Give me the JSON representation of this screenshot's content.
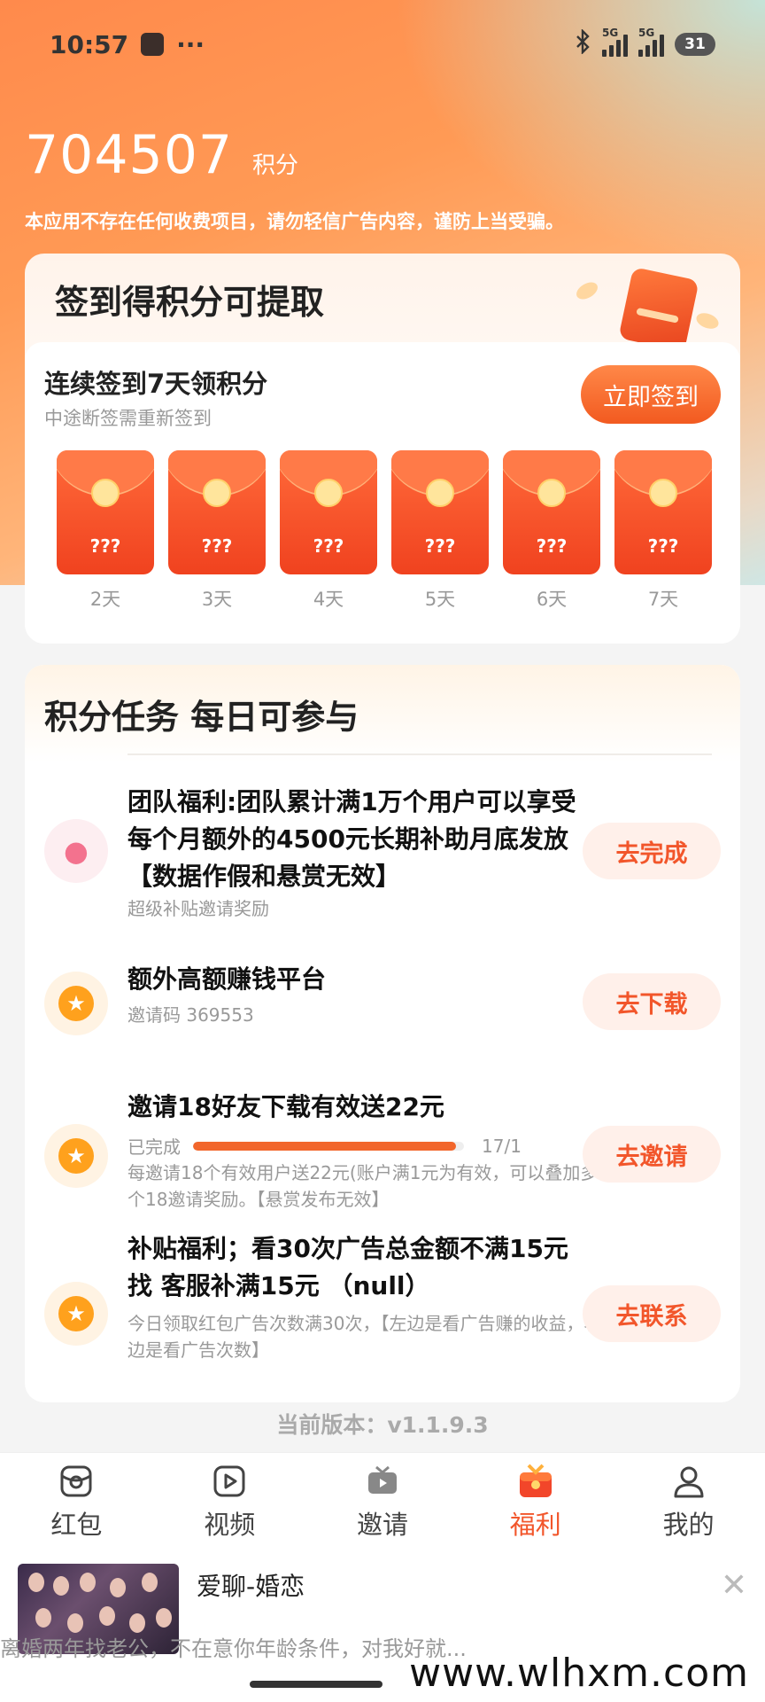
{
  "status_bar": {
    "time": "10:57",
    "more": "···",
    "signal_1": "5G",
    "signal_2": "5G",
    "battery": "31"
  },
  "header": {
    "points_value": "704507",
    "points_unit": "积分",
    "notice": "本应用不存在任何收费项目，请勿轻信广告内容，谨防上当受骗。"
  },
  "checkin": {
    "title": "签到得积分可提取",
    "sub_title": "连续签到7天领积分",
    "hint": "中途断签需重新签到",
    "button": "立即签到",
    "days": [
      {
        "reward": "???",
        "label": "2天"
      },
      {
        "reward": "???",
        "label": "3天"
      },
      {
        "reward": "???",
        "label": "4天"
      },
      {
        "reward": "???",
        "label": "5天"
      },
      {
        "reward": "???",
        "label": "6天"
      },
      {
        "reward": "???",
        "label": "7天"
      }
    ]
  },
  "tasks": {
    "title": "积分任务  每日可参与",
    "items": [
      {
        "title": "团队福利:团队累计满1万个用户可以享受每个月额外的4500元长期补助月底发放【数据作假和悬赏无效】",
        "sub": "超级补贴邀请奖励",
        "button": "去完成"
      },
      {
        "title": "额外高额赚钱平台",
        "sub": "邀请码 369553",
        "button": "去下载"
      },
      {
        "title": "邀请18好友下载有效送22元",
        "progress_label": "已完成",
        "progress_fraction": 0.97,
        "progress_count": "17/1",
        "sub": "每邀请18个有效用户送22元(账户满1元为有效，可以叠加多个18邀请奖励。【悬赏发布无效】",
        "button": "去邀请"
      },
      {
        "title": "补贴福利；看30次广告总金额不满15元找 客服补满15元 （null）",
        "sub": "今日领取红包广告次数满30次，【左边是看广告赚的收益，右边是看广告次数】",
        "button": "去联系"
      }
    ]
  },
  "version": "当前版本：v1.1.9.3",
  "tabbar": [
    {
      "label": "红包",
      "icon": "red-packet-icon",
      "active": false
    },
    {
      "label": "视频",
      "icon": "video-icon",
      "active": false
    },
    {
      "label": "邀请",
      "icon": "tv-icon",
      "active": false
    },
    {
      "label": "福利",
      "icon": "gift-icon",
      "active": true
    },
    {
      "label": "我的",
      "icon": "person-icon",
      "active": false
    }
  ],
  "ad": {
    "title": "爱聊-婚恋",
    "desc": "离婚两年找老公，不在意你年龄条件，对我好就..."
  },
  "watermark": "www.wlhxm.com",
  "colors": {
    "accent": "#f2562b",
    "hero": "#ff8a4c",
    "coin": "#ffa11d"
  }
}
